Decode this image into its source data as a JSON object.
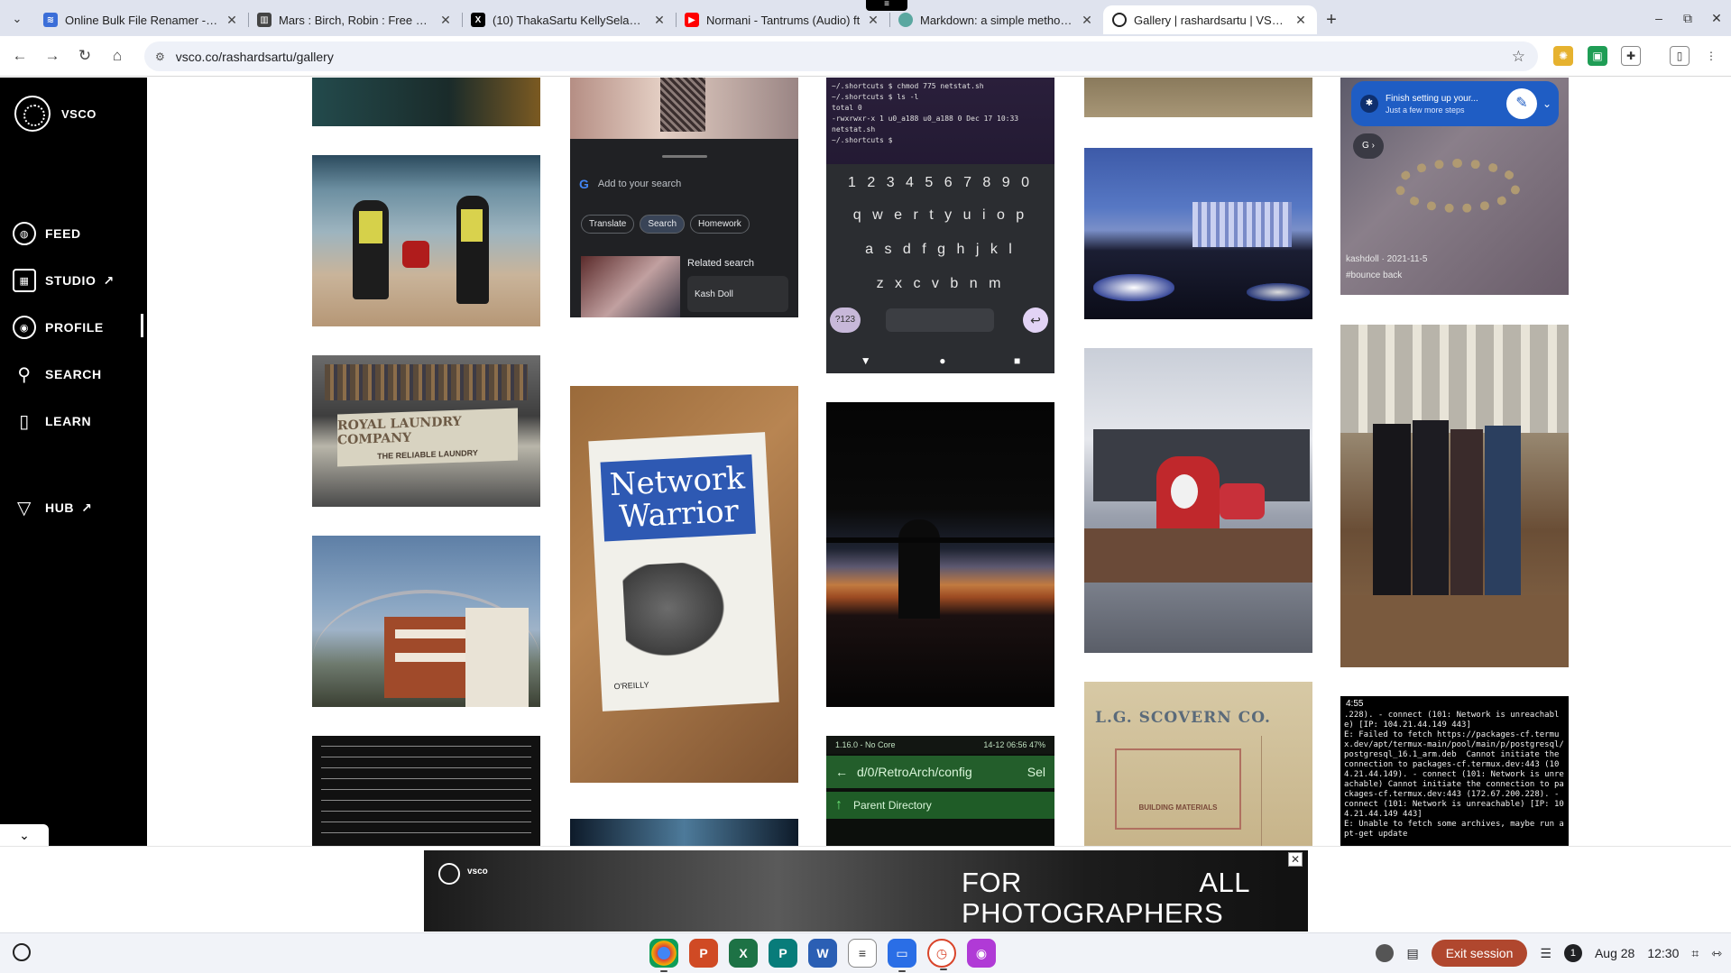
{
  "browser": {
    "tabs": [
      {
        "title": "Online Bulk File Renamer - Web",
        "favicon_color": "#3b6ed8"
      },
      {
        "title": "Mars : Birch, Robin : Free Down",
        "favicon_color": "#444444"
      },
      {
        "title": "(10) ThakaSartu KellySelassie",
        "favicon_color": "#000000"
      },
      {
        "title": "Normani - Tantrums (Audio) ft",
        "favicon_color": "#ff0000"
      },
      {
        "title": "Markdown: a simple method fo",
        "favicon_color": "#5aa7a0"
      },
      {
        "title": "Gallery | rashardsartu | VSCO",
        "favicon_color": "#222222",
        "active": true
      }
    ],
    "url": "vsco.co/rashardsartu/gallery"
  },
  "sidebar": {
    "brand": "VSCO",
    "items": [
      {
        "label": "FEED",
        "icon": "globe-icon"
      },
      {
        "label": "STUDIO",
        "icon": "studio-icon",
        "external": true
      },
      {
        "label": "PROFILE",
        "icon": "profile-icon"
      },
      {
        "label": "SEARCH",
        "icon": "search-icon"
      },
      {
        "label": "LEARN",
        "icon": "book-icon"
      },
      {
        "label": "HUB",
        "icon": "hub-icon",
        "external": true
      }
    ]
  },
  "gallery": {
    "google_search": {
      "placeholder": "Add to your search",
      "chips": [
        "Translate",
        "Search",
        "Homework"
      ],
      "related_label": "Related search",
      "related_item": "Kash Doll"
    },
    "terminal": {
      "lines": [
        "~/.shortcuts $ chmod 775 netstat.sh",
        "~/.shortcuts $ ls -l",
        "total 0",
        "-rwxrwxr-x 1 u0_a188 u0_a188 0 Dec 17 10:33",
        "netstat.sh",
        "~/.shortcuts $ "
      ],
      "numbers": "1 2 3 4 5 6 7 8 9 0",
      "row1": "q w e r t y u i o p",
      "row2": "a s d f g h j k l",
      "row3": "z x c v b n m",
      "sym_key": "?123"
    },
    "assistant": {
      "title": "Finish setting up your...",
      "subtitle": "Just a few more steps",
      "handle": "kashdoll",
      "date": "2021-11-5",
      "caption": "#bounce back"
    },
    "laundry_sign": {
      "line1": "ROYAL LAUNDRY COMPANY",
      "line2": "THE RELIABLE LAUNDRY"
    },
    "book": {
      "title_line1": "Network",
      "title_line2": "Warrior",
      "publisher": "O'REILLY"
    },
    "retroarch": {
      "status_left": "1.16.0 - No Core",
      "status_right": "14-12 06:56",
      "battery": "47%",
      "path": "d/0/RetroArch/config",
      "sel": "Sel",
      "parent": "Parent Directory"
    },
    "scovern": {
      "line1": "L.G. SCOVERN CO.",
      "line2": "BUILDING MATERIALS"
    },
    "termux_error": {
      "time": "4:55",
      "text": ".228). - connect (101: Network is unreachable) [IP: 104.21.44.149 443]\nE: Failed to fetch https://packages-cf.termux.dev/apt/termux-main/pool/main/p/postgresql/postgresql_16.1_arm.deb  Cannot initiate the connection to packages-cf.termux.dev:443 (104.21.44.149). - connect (101: Network is unreachable) Cannot initiate the connection to packages-cf.termux.dev:443 (172.67.200.228). - connect (101: Network is unreachable) [IP: 104.21.44.149 443]\nE: Unable to fetch some archives, maybe run apt-get update"
    }
  },
  "ad": {
    "brand": "vsco",
    "headline_left": "FOR",
    "headline_right": "ALL",
    "headline_line2": "PHOTOGRAPHERS"
  },
  "shelf": {
    "exit_label": "Exit session",
    "notification_count": "1",
    "date": "Aug 28",
    "time": "12:30"
  }
}
